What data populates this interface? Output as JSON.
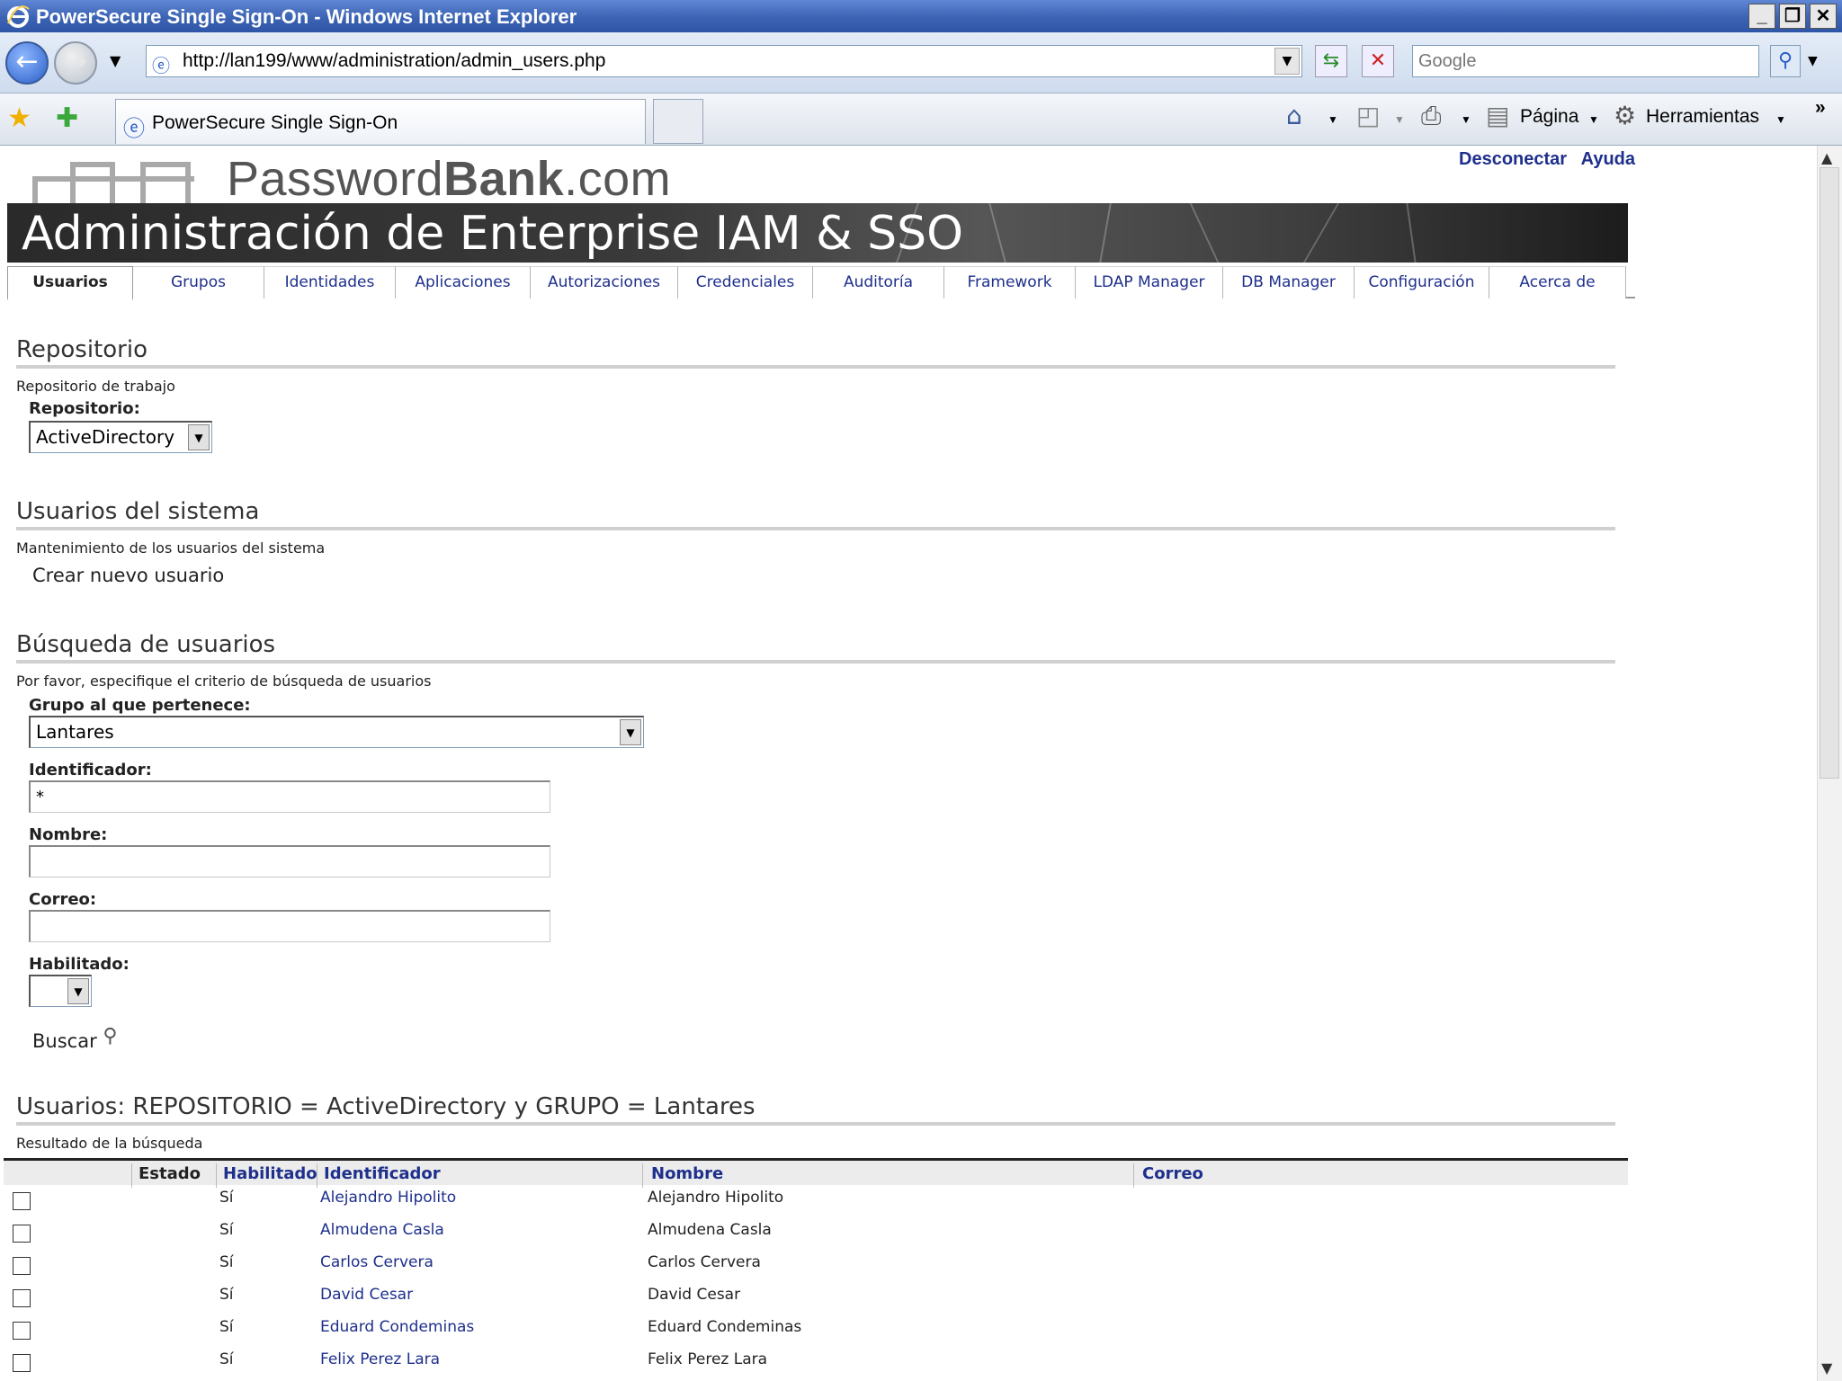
{
  "window": {
    "title": "PowerSecure Single Sign-On - Windows Internet Explorer"
  },
  "address_bar": {
    "url": "http://lan199/www/administration/admin_users.php",
    "search_placeholder": "Google"
  },
  "browser_tab": {
    "label": "PowerSecure Single Sign-On"
  },
  "command_bar": {
    "page_label": "Página",
    "tools_label": "Herramientas"
  },
  "site": {
    "logo_prefix": "Password",
    "logo_bold": "Bank",
    "logo_suffix": ".com",
    "links": {
      "logout": "Desconectar",
      "help": "Ayuda"
    },
    "banner_title": "Administración de Enterprise IAM & SSO"
  },
  "menu_tabs": [
    {
      "label": "Usuarios"
    },
    {
      "label": "Grupos"
    },
    {
      "label": "Identidades"
    },
    {
      "label": "Aplicaciones"
    },
    {
      "label": "Autorizaciones"
    },
    {
      "label": "Credenciales"
    },
    {
      "label": "Auditoría"
    },
    {
      "label": "Framework"
    },
    {
      "label": "LDAP Manager"
    },
    {
      "label": "DB Manager"
    },
    {
      "label": "Configuración"
    },
    {
      "label": "Acerca de"
    }
  ],
  "repository_section": {
    "title": "Repositorio",
    "subtitle": "Repositorio de trabajo",
    "field_label": "Repositorio:",
    "selected": "ActiveDirectory"
  },
  "system_users_section": {
    "title": "Usuarios del sistema",
    "subtitle": "Mantenimiento de los usuarios del sistema",
    "create_link": "Crear nuevo usuario"
  },
  "search_section": {
    "title": "Búsqueda de usuarios",
    "subtitle": "Por favor, especifique el criterio de búsqueda de usuarios",
    "group_label": "Grupo al que pertenece:",
    "group_selected": "Lantares",
    "identifier_label": "Identificador:",
    "identifier_value": "*",
    "name_label": "Nombre:",
    "name_value": "",
    "email_label": "Correo:",
    "email_value": "",
    "enabled_label": "Habilitado:",
    "enabled_selected": "",
    "search_button": "Buscar"
  },
  "results_section": {
    "title": "Usuarios: REPOSITORIO = ActiveDirectory y GRUPO = Lantares",
    "subtitle": "Resultado de la búsqueda",
    "columns": [
      "Estado",
      "Habilitado",
      "Identificador",
      "Nombre",
      "Correo"
    ],
    "rows": [
      {
        "enabled": "Sí",
        "identifier": "Alejandro Hipolito",
        "name": "Alejandro Hipolito"
      },
      {
        "enabled": "Sí",
        "identifier": "Almudena Casla",
        "name": "Almudena Casla"
      },
      {
        "enabled": "Sí",
        "identifier": "Carlos Cervera",
        "name": "Carlos Cervera"
      },
      {
        "enabled": "Sí",
        "identifier": "David Cesar",
        "name": "David Cesar"
      },
      {
        "enabled": "Sí",
        "identifier": "Eduard Condeminas",
        "name": "Eduard Condeminas"
      },
      {
        "enabled": "Sí",
        "identifier": "Felix Perez Lara",
        "name": "Felix Perez Lara"
      }
    ]
  },
  "colors": {
    "link": "#1e2f8c",
    "titlebar": "#3c63b4"
  },
  "icons": [
    "ie-logo-icon",
    "back-icon",
    "forward-icon",
    "refresh-icon",
    "stop-icon",
    "search-icon",
    "favorites-star-icon",
    "add-favorites-icon",
    "home-icon",
    "feeds-icon",
    "print-icon",
    "page-icon",
    "tools-gear-icon",
    "magnifier-icon"
  ]
}
